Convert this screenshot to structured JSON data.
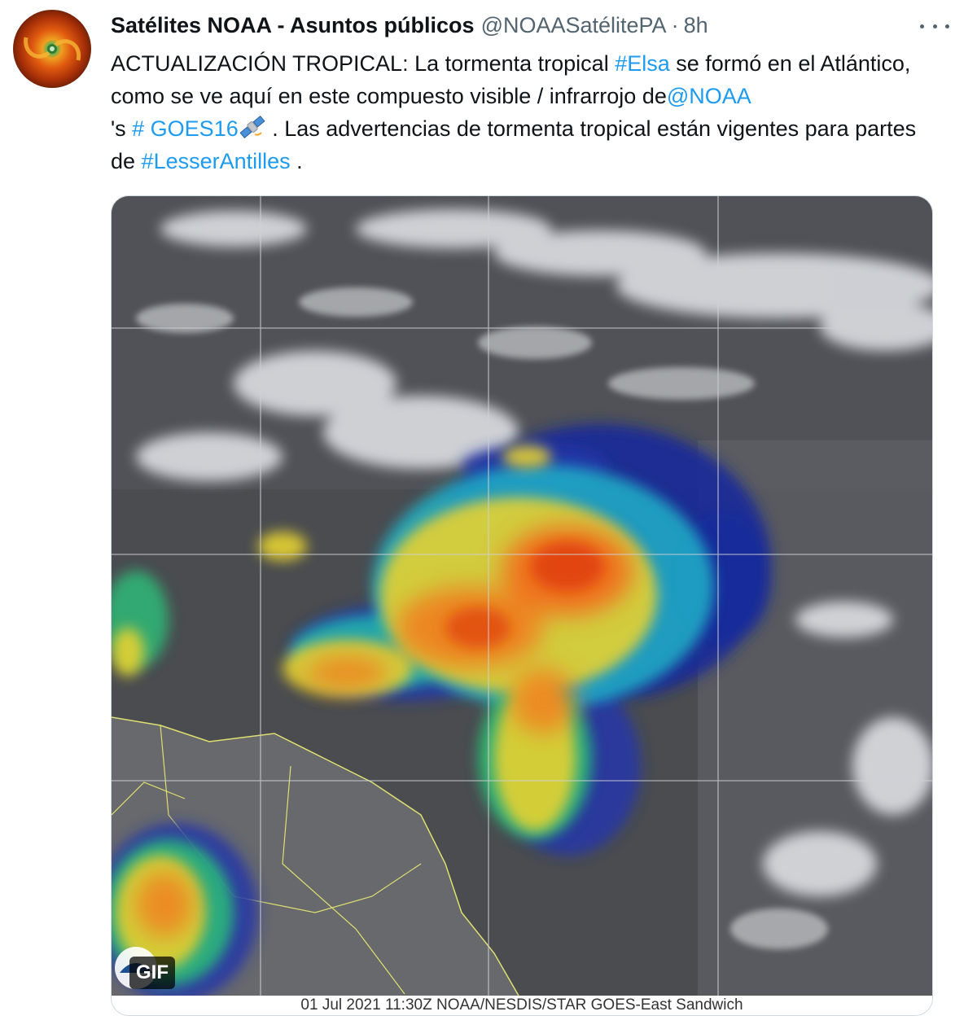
{
  "header": {
    "display_name": "Satélites NOAA - Asuntos públicos",
    "handle": "@NOAASatélitePA",
    "separator": "·",
    "time": "8h"
  },
  "icons": {
    "more": "more-horizontal-icon",
    "satellite_emoji": "satellite-emoji-icon",
    "avatar": "hurricane-avatar"
  },
  "tweet": {
    "part1": "ACTUALIZACIÓN TROPICAL: La tormenta tropical ",
    "hashtag_elsa": "#Elsa",
    "part2": " se formó en el Atlántico, como se ve aquí en este compuesto visible / infrarrojo de",
    "mention_noaa": "@NOAA",
    "part3": " 's ",
    "hashtag_goes": "# GOES16",
    "part4": " . Las advertencias de tormenta tropical están vigentes para partes de ",
    "hashtag_antilles": "#LesserAntilles",
    "part5": " ."
  },
  "media": {
    "caption": "01 Jul 2021 11:30Z NOAA/NESDIS/STAR GOES-East Sandwich",
    "badge": "GIF"
  },
  "colors": {
    "link": "#1d9bf0",
    "text": "#0f1419",
    "secondary": "#536471"
  }
}
